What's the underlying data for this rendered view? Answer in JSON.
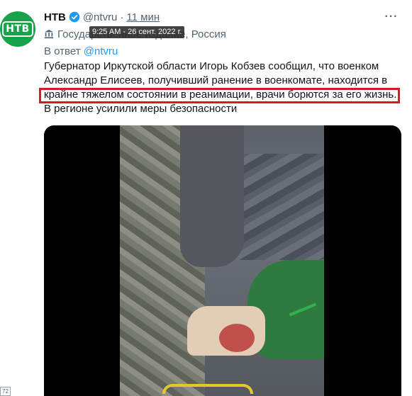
{
  "tweet": {
    "author_name": "НТВ",
    "author_handle": "@ntvru",
    "separator": "·",
    "time_ago": "11 мин",
    "label": "Государственное издание, Россия",
    "tooltip": "9:25 AM - 26 сент. 2022 г.",
    "reply_prefix": "В ответ",
    "reply_handle": "@ntvru",
    "text_lines": [
      "Губернатор Иркутской области Игорь Кобзев сообщил, что военком",
      "Александр Елисеев, получивший ранение в военкомате, находится в",
      "крайне тяжелом состоянии в реанимации, врачи борются за его жизнь.",
      "В регионе усилили меры безопасности"
    ]
  },
  "avatar": {
    "logo_text": "НТВ"
  },
  "side_badge": {
    "text": "72"
  },
  "colors": {
    "highlight": "#d61a2a",
    "link": "#1d9bf0",
    "muted": "#536471",
    "avatar_bg": "#16a34a"
  },
  "icons": {
    "verified": "verified-badge-icon",
    "more": "more-options-icon",
    "label": "government-building-icon"
  }
}
